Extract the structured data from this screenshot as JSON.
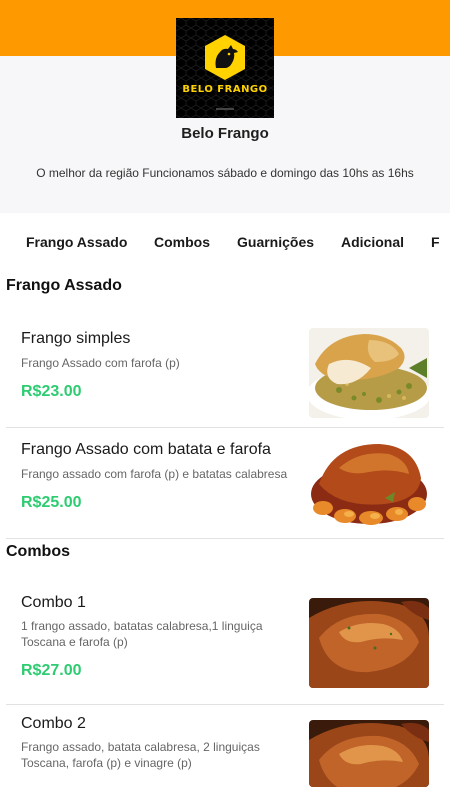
{
  "store": {
    "logo_text": "BELO FRANGO",
    "name": "Belo Frango",
    "description": "O melhor da região Funcionamos sábado e domingo das 10hs as 16hs"
  },
  "tabs": [
    "Frango Assado",
    "Combos",
    "Guarnições",
    "Adicional",
    "F"
  ],
  "sections": [
    {
      "title": "Frango Assado",
      "items": [
        {
          "name": "Frango simples",
          "description": "Frango Assado com farofa (p)",
          "price": "R$23.00",
          "image": "roast-chicken-with-farofa-photo"
        },
        {
          "name": "Frango Assado com batata e farofa",
          "description": "Frango assado com farofa (p) e batatas calabresa",
          "price": "R$25.00",
          "image": "roast-chicken-with-potatoes-photo"
        }
      ]
    },
    {
      "title": "Combos",
      "items": [
        {
          "name": "Combo 1",
          "description": "1 frango assado, batatas calabresa,1 linguiça Toscana e farofa (p)",
          "price": "R$27.00",
          "image": "roast-chicken-closeup-photo"
        },
        {
          "name": "Combo 2",
          "description": "Frango assado, batata calabresa, 2 linguiças Toscana, farofa (p) e vinagre (p)",
          "price": "",
          "image": "roast-chicken-closeup-photo"
        }
      ]
    }
  ],
  "colors": {
    "top_bar": "#ff9900",
    "price": "#2ecc71",
    "logo_yellow": "#ffd200"
  }
}
